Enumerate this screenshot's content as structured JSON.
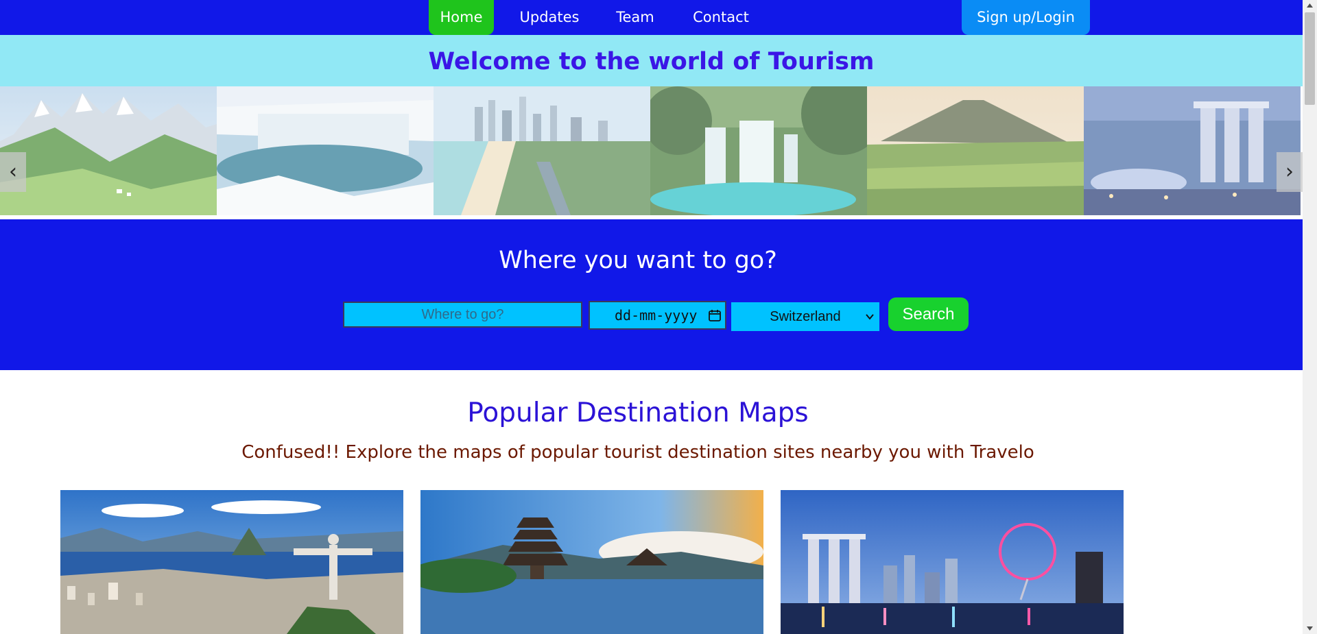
{
  "nav": {
    "home": "Home",
    "updates": "Updates",
    "team": "Team",
    "contact": "Contact",
    "signup": "Sign up/Login",
    "colors": {
      "bar": "#1118e8",
      "home_active": "#1fc41c",
      "signup": "#0a8cf5"
    }
  },
  "hero": {
    "title": "Welcome to the world of Tourism",
    "prev_glyph": "‹",
    "next_glyph": "›",
    "slides": [
      {
        "name": "alpine-meadow-slide"
      },
      {
        "name": "frozen-waterfall-slide"
      },
      {
        "name": "city-beach-skyline-slide"
      },
      {
        "name": "jungle-waterfall-slide"
      },
      {
        "name": "rice-terrace-volcano-slide"
      },
      {
        "name": "marina-bay-night-slide"
      }
    ]
  },
  "search": {
    "title": "Where you want to go?",
    "destination_placeholder": "Where to go?",
    "date_placeholder": "dd-mm-yyyy",
    "country_selected": "Switzerland",
    "button": "Search"
  },
  "popular": {
    "title": "Popular Destination Maps",
    "subtitle": "Confused!! Explore the maps of popular tourist destination sites nearby you with Travelo",
    "cards": [
      {
        "name": "rio-christ-redeemer-card"
      },
      {
        "name": "bali-temple-card"
      },
      {
        "name": "singapore-skyline-card"
      }
    ]
  }
}
